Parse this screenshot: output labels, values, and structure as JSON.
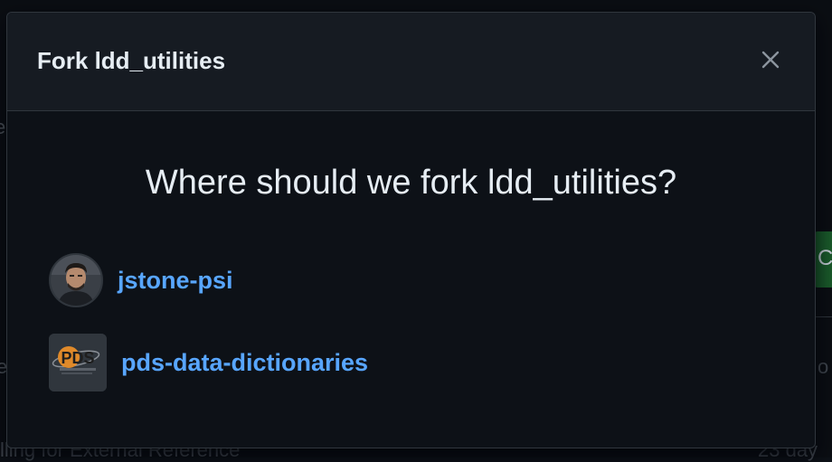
{
  "dialog": {
    "title": "Fork ldd_utilities",
    "question": "Where should we fork ldd_utilities?",
    "close_icon": "close-icon"
  },
  "owners": [
    {
      "name": "jstone-psi",
      "avatar_icon": "user-avatar-icon"
    },
    {
      "name": "pds-data-dictionaries",
      "avatar_icon": "pds-logo-icon",
      "logo_text": "PDS"
    }
  ],
  "background": {
    "footer_left": "lling for External Reference",
    "footer_right": "23 day",
    "right_mid": "o",
    "green_button_letter": "C",
    "left_edge_letter": "e",
    "left_edge_letter2": "e"
  },
  "colors": {
    "link": "#58a6ff",
    "modal_bg": "#0d1117",
    "header_bg": "#161b22",
    "border": "#30363d"
  }
}
